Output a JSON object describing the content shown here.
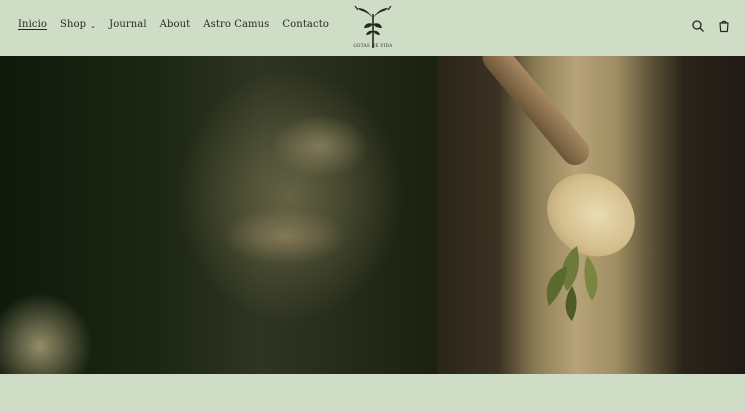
{
  "nav": {
    "items": [
      {
        "label": "Inicio",
        "active": true,
        "has_dropdown": false
      },
      {
        "label": "Shop",
        "active": false,
        "has_dropdown": true
      },
      {
        "label": "Journal",
        "active": false,
        "has_dropdown": false
      },
      {
        "label": "About",
        "active": false,
        "has_dropdown": false
      },
      {
        "label": "Astro Camus",
        "active": false,
        "has_dropdown": false
      },
      {
        "label": "Contacto",
        "active": false,
        "has_dropdown": false
      }
    ]
  },
  "logo": {
    "text": "GOTAS DE VIDA",
    "icon": "plant-crest-logo"
  },
  "header_icons": [
    "search-icon",
    "cart-icon"
  ],
  "colors": {
    "background": "#cfdcc6",
    "text": "#1f2a1e"
  },
  "hero": {
    "left_image": "blurred-face-photo",
    "right_image": "hand-holding-bowl-with-leaves-photo"
  }
}
